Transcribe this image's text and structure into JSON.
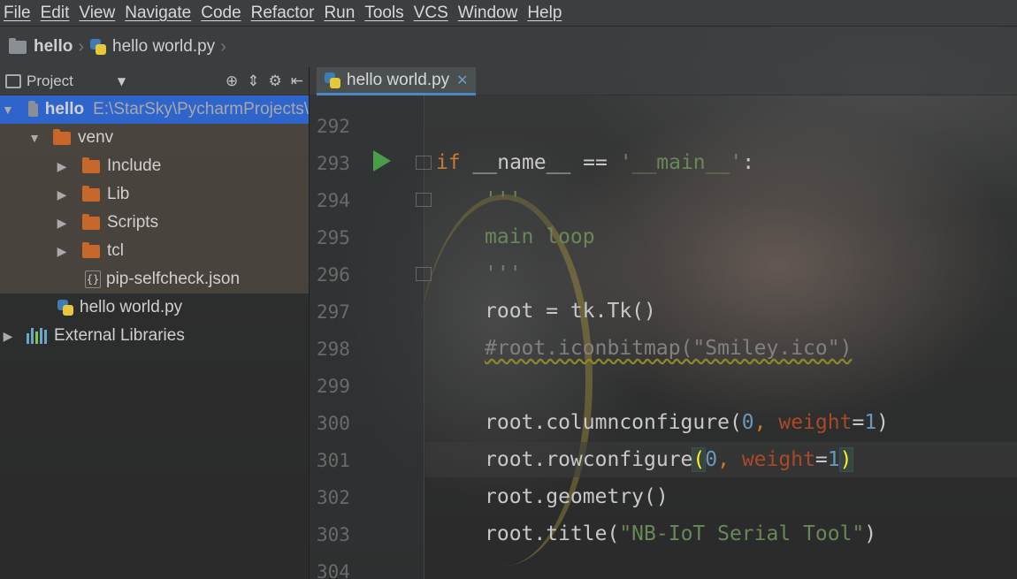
{
  "menu": [
    "File",
    "Edit",
    "View",
    "Navigate",
    "Code",
    "Refactor",
    "Run",
    "Tools",
    "VCS",
    "Window",
    "Help"
  ],
  "breadcrumb": {
    "project": "hello",
    "file": "hello world.py"
  },
  "project_panel": {
    "title": "Project",
    "tree": [
      {
        "label": "hello",
        "path": "E:\\StarSky\\PycharmProjects\\",
        "type": "root"
      },
      {
        "label": "venv",
        "type": "folder"
      },
      {
        "label": "Include",
        "type": "folder"
      },
      {
        "label": "Lib",
        "type": "folder"
      },
      {
        "label": "Scripts",
        "type": "folder"
      },
      {
        "label": "tcl",
        "type": "folder"
      },
      {
        "label": "pip-selfcheck.json",
        "type": "json"
      },
      {
        "label": "hello world.py",
        "type": "python"
      },
      {
        "label": "External Libraries",
        "type": "libraries"
      }
    ]
  },
  "editor": {
    "tab_label": "hello world.py",
    "line_numbers": [
      "292",
      "293",
      "294",
      "295",
      "296",
      "297",
      "298",
      "299",
      "300",
      "301",
      "302",
      "303",
      "304"
    ],
    "code": {
      "l293_kw": "if",
      "l293_rest": " __name__ == ",
      "l293_str": "'__main__'",
      "l293_colon": ":",
      "l294": "'''",
      "l295": "main loop",
      "l296": "'''",
      "l297": "root = tk.Tk()",
      "l298": "#root.iconbitmap(\"Smiley.ico\")",
      "l300_a": "root.columnconfigure(",
      "l300_num": "0",
      "l300_comma": ", ",
      "l300_param": "weight",
      "l300_eq": "=",
      "l300_val": "1",
      "l300_close": ")",
      "l301_a": "root.rowconfigure",
      "l301_open": "(",
      "l301_num": "0",
      "l301_comma": ", ",
      "l301_param": "weight",
      "l301_eq": "=",
      "l301_val": "1",
      "l301_close": ")",
      "l302": "root.geometry()",
      "l303_a": "root.title(",
      "l303_str": "\"NB-IoT Serial Tool\"",
      "l303_close": ")"
    }
  }
}
